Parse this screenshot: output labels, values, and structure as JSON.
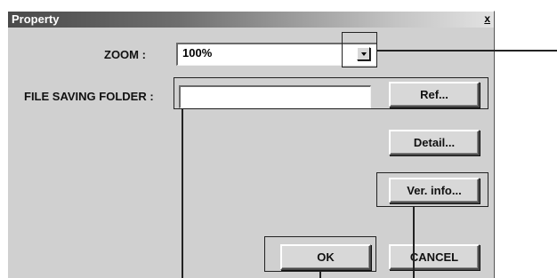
{
  "window": {
    "title": "Property",
    "close_label": "x"
  },
  "zoom": {
    "label": "ZOOM :",
    "value": "100%"
  },
  "folder": {
    "label": "FILE SAVING FOLDER :",
    "value": "",
    "ref_label": "Ref..."
  },
  "buttons": {
    "detail_label": "Detail...",
    "version_label": "Ver. info...",
    "ok_label": "OK",
    "cancel_label": "CANCEL"
  }
}
